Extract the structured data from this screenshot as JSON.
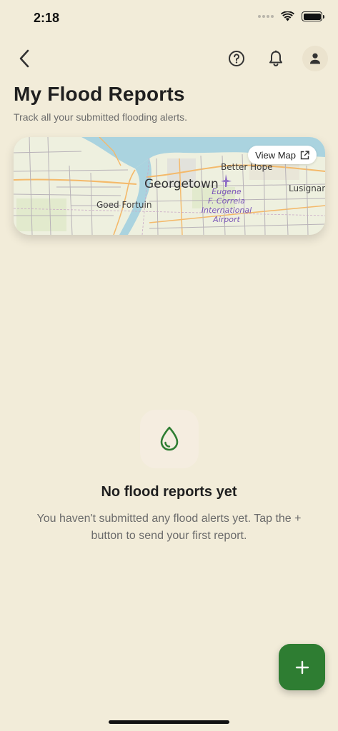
{
  "status_bar": {
    "time": "2:18"
  },
  "nav": {
    "back_icon": "chevron-left-icon",
    "help_icon": "help-circle-icon",
    "notifications_icon": "bell-icon",
    "profile_icon": "person-icon"
  },
  "header": {
    "title": "My Flood Reports",
    "subtitle": "Track all your submitted flooding alerts."
  },
  "map": {
    "view_map_label": "View Map",
    "view_map_icon": "external-link-icon",
    "labels": {
      "city": "Georgetown",
      "better_hope": "Better Hope",
      "goed_fortuin": "Goed Fortuin",
      "lusignan": "Lusignan",
      "airport_line1": "Eugene",
      "airport_line2": "F. Correia",
      "airport_line3": "International",
      "airport_line4": "Airport"
    }
  },
  "empty_state": {
    "icon": "water-drop-icon",
    "title": "No flood reports yet",
    "message": "You haven't submitted any flood alerts yet. Tap the + button to send your first report."
  },
  "fab": {
    "icon": "plus-icon"
  },
  "colors": {
    "background": "#f2ecd9",
    "accent": "#2e7d32",
    "water": "#a9cfe0"
  }
}
